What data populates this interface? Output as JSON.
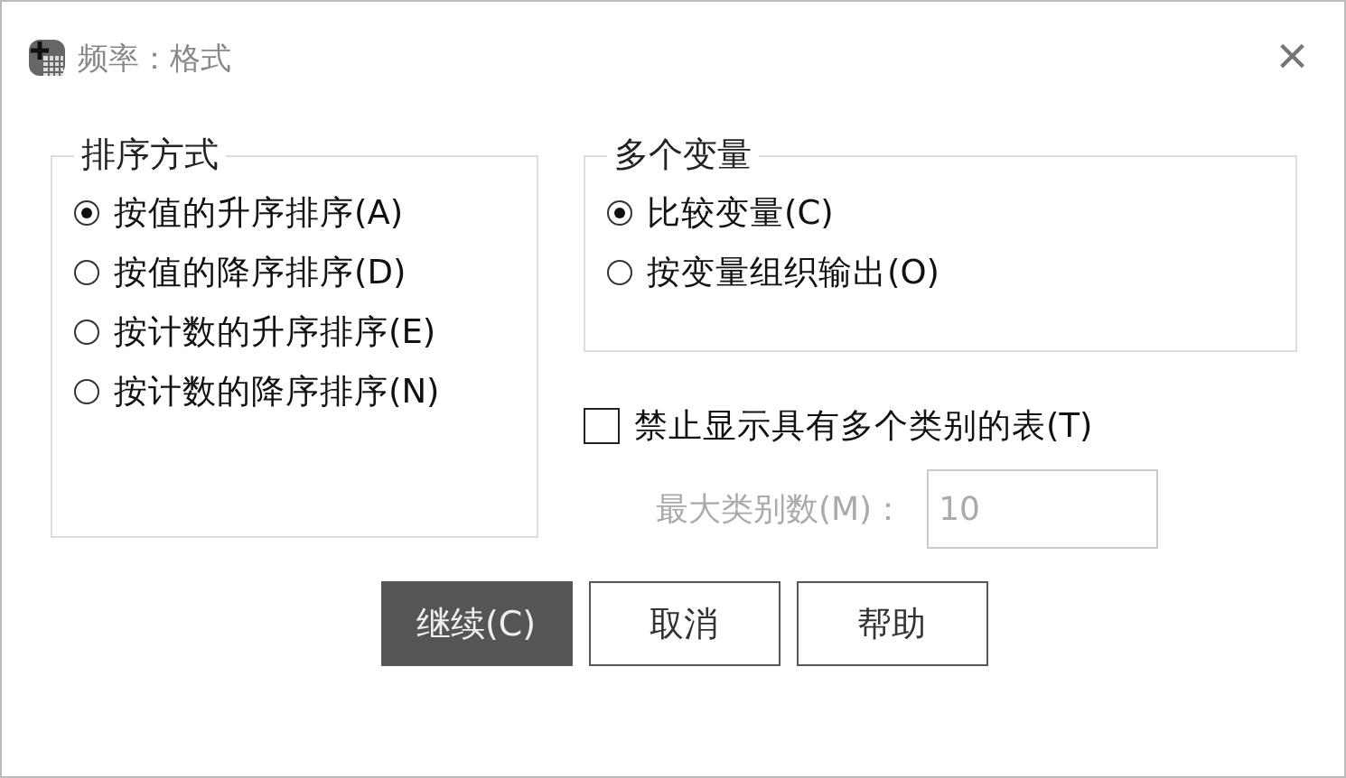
{
  "window": {
    "title": "频率：格式",
    "close": "×"
  },
  "sort_order": {
    "title": "排序方式",
    "options": [
      {
        "label": "按值的升序排序(A)",
        "selected": true
      },
      {
        "label": "按值的降序排序(D)",
        "selected": false
      },
      {
        "label": "按计数的升序排序(E)",
        "selected": false
      },
      {
        "label": "按计数的降序排序(N)",
        "selected": false
      }
    ]
  },
  "multiple_variables": {
    "title": "多个变量",
    "options": [
      {
        "label": "比较变量(C)",
        "selected": true
      },
      {
        "label": "按变量组织输出(O)",
        "selected": false
      }
    ]
  },
  "suppress_tables": {
    "label": "禁止显示具有多个类别的表(T)",
    "checked": false
  },
  "max_categories": {
    "label": "最大类别数(M)：",
    "value": "10",
    "disabled": true
  },
  "buttons": [
    {
      "label": "继续(C)",
      "default": true
    },
    {
      "label": "取消",
      "default": false
    },
    {
      "label": "帮助",
      "default": false
    }
  ]
}
